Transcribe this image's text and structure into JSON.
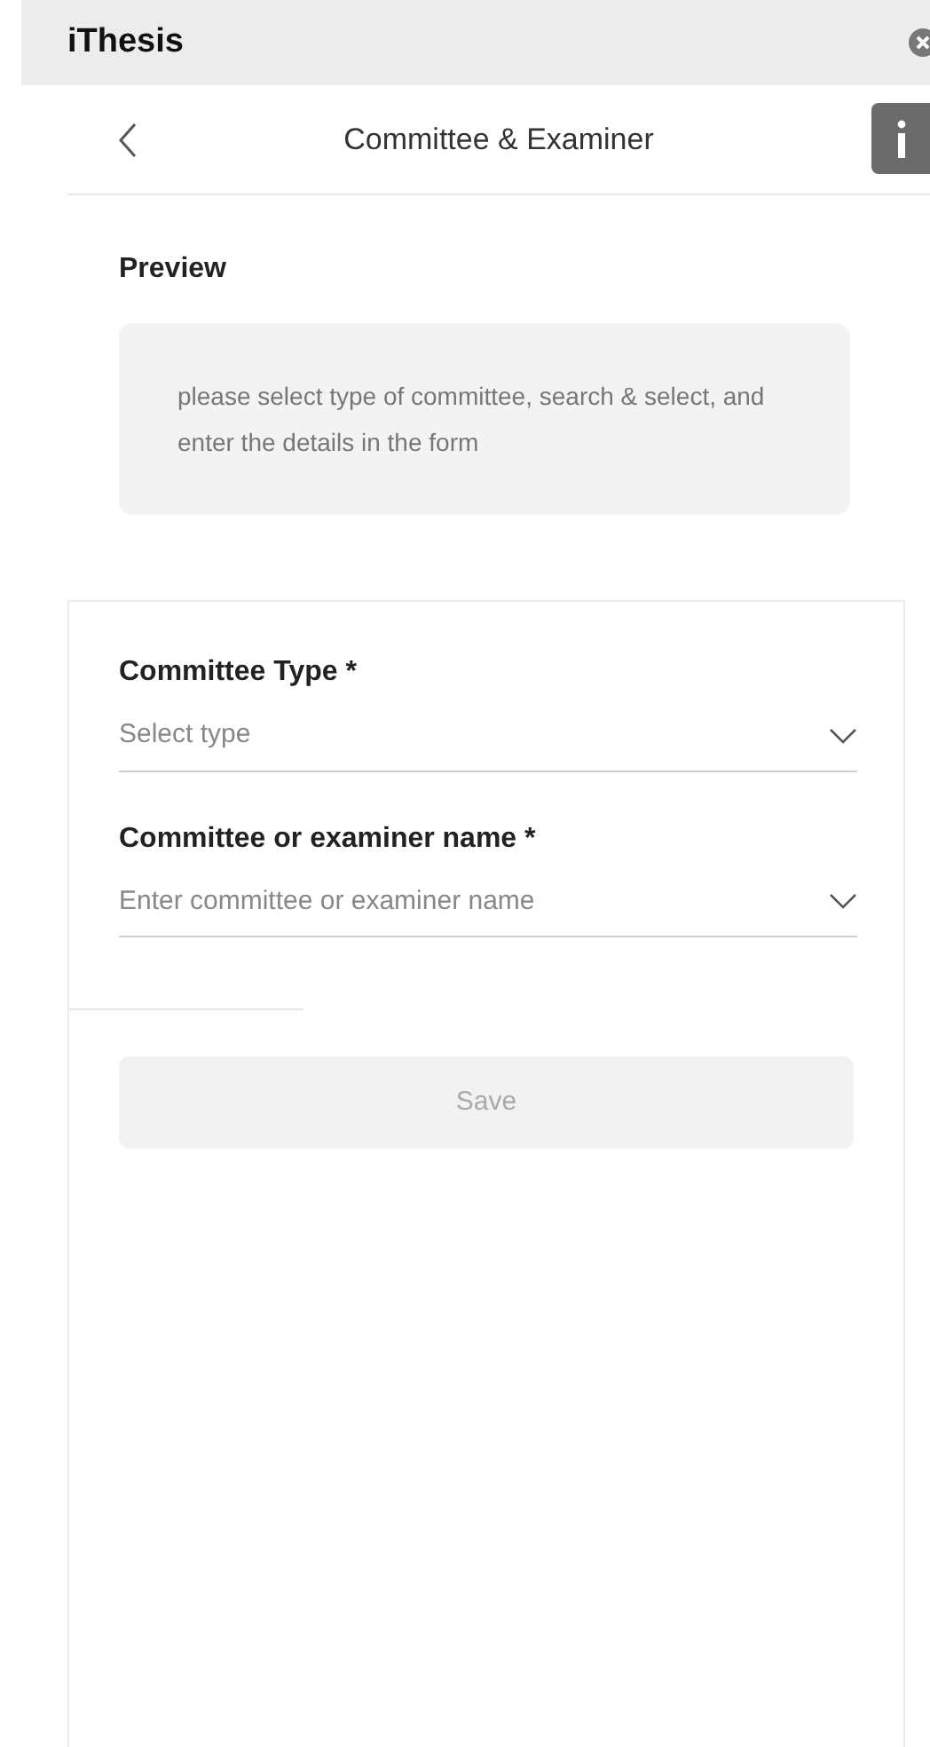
{
  "app_bar": {
    "title": "iThesis"
  },
  "header": {
    "title": "Committee & Examiner"
  },
  "preview": {
    "label": "Preview",
    "message": "please select type of committee, search & select, and enter the details in the form"
  },
  "form": {
    "fields": [
      {
        "label": "Committee Type *",
        "placeholder": "Select type"
      },
      {
        "label": "Committee or examiner name *",
        "placeholder": "Enter committee or examiner name"
      }
    ],
    "save_button": {
      "label": "Save",
      "disabled": true
    }
  }
}
